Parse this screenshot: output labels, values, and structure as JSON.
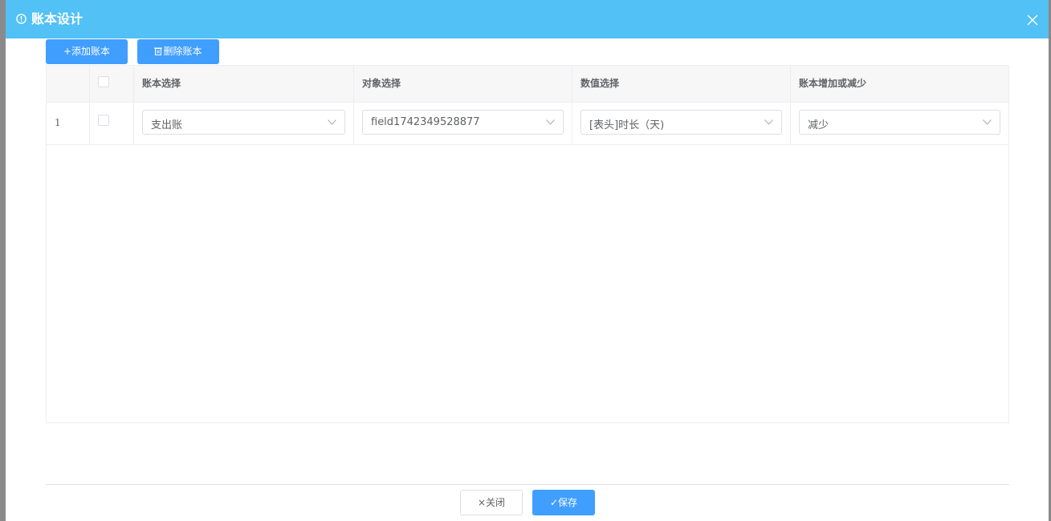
{
  "dialog": {
    "title": "账本设计",
    "header_color": "#52c1f5"
  },
  "toolbar": {
    "add_label": "+添加账本",
    "delete_label": "删除账本"
  },
  "table": {
    "columns": [
      "",
      "",
      "账本选择",
      "对象选择",
      "数值选择",
      "账本增加或减少"
    ],
    "rows": [
      {
        "index": "1",
        "checked": false,
        "ledger": "支出账",
        "object": "field1742349528877",
        "value": "[表头]时长（天)",
        "direction": "减少"
      }
    ]
  },
  "footer": {
    "close_label": "×关闭",
    "save_label": "✓保存"
  },
  "colors": {
    "primary": "#409eff"
  }
}
